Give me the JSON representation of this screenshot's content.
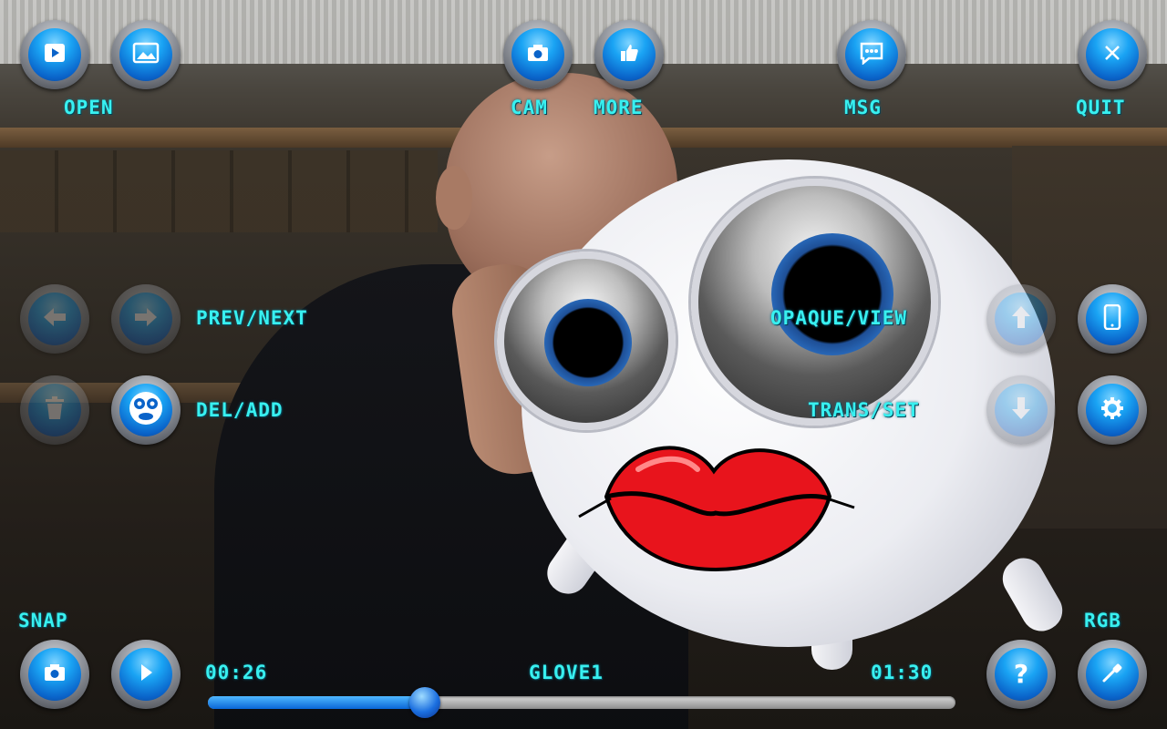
{
  "top_bar": {
    "open_label": "OPEN",
    "cam_label": "CAM",
    "more_label": "MORE",
    "msg_label": "MSG",
    "quit_label": "QUIT"
  },
  "left_controls": {
    "prev_next_label": "PREV/NEXT",
    "del_add_label": "DEL/ADD"
  },
  "right_controls": {
    "opaque_view_label": "OPAQUE/VIEW",
    "trans_set_label": "TRANS/SET"
  },
  "bottom_bar": {
    "snap_label": "SNAP",
    "rgb_label": "RGB",
    "elapsed_time": "00:26",
    "clip_name": "GLOVE1",
    "total_time": "01:30",
    "progress_fraction": 0.29
  },
  "icons": {
    "play": "play-icon",
    "image": "image-icon",
    "camera": "camera-icon",
    "thumbs_up": "thumbs-up-icon",
    "message": "message-icon",
    "close": "close-icon",
    "arrow_left": "arrow-left-icon",
    "arrow_right": "arrow-right-icon",
    "trash": "trash-icon",
    "face": "face-icon",
    "arrow_up": "arrow-up-icon",
    "arrow_down": "arrow-down-icon",
    "tablet": "tablet-icon",
    "gear": "gear-icon",
    "help": "help-icon",
    "eyedropper": "eyedropper-icon"
  },
  "colors": {
    "label_cyan": "#38f0f0",
    "button_blue": "#1aa4f4",
    "lips_red": "#e8141c"
  }
}
